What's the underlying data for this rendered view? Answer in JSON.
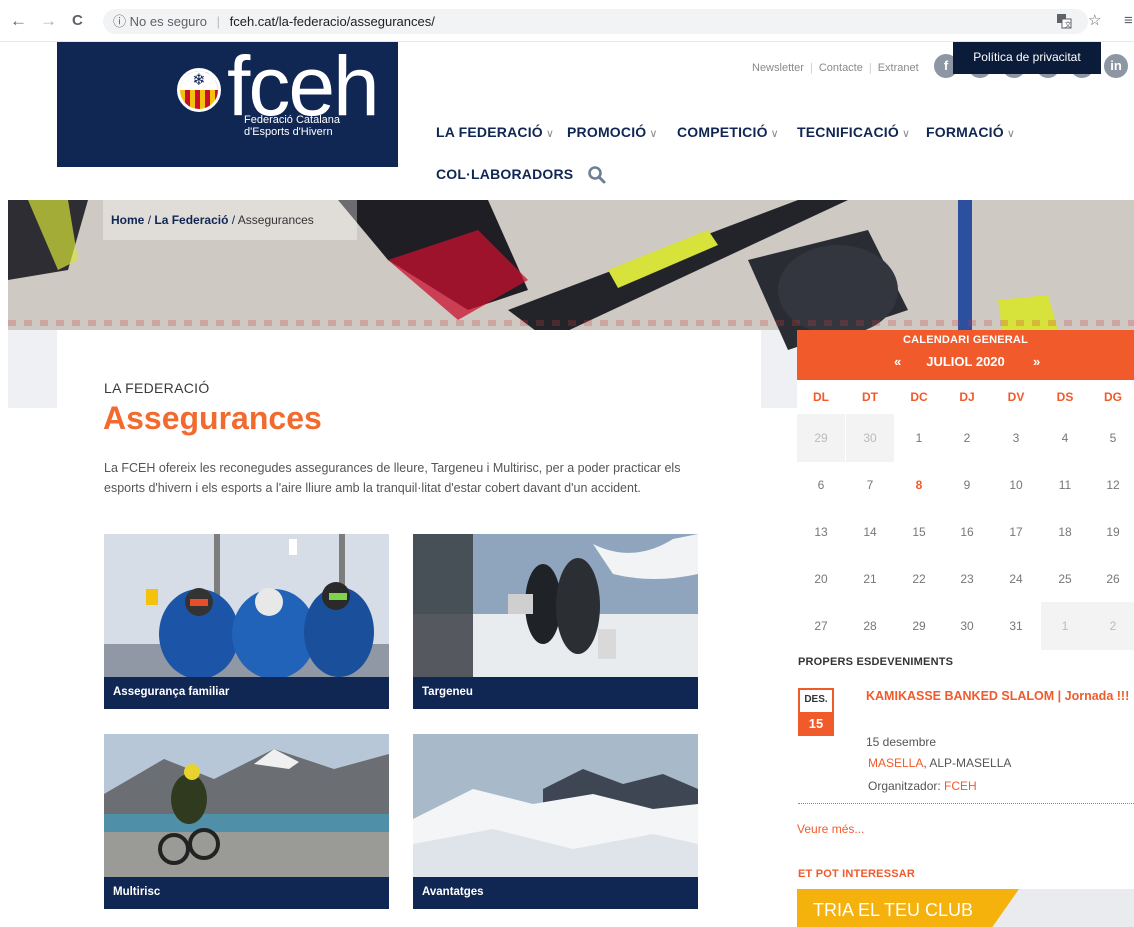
{
  "browser": {
    "back_glyph": "←",
    "forward_glyph": "→",
    "reload_glyph": "C",
    "security_label": "No es seguro",
    "url": "fceh.cat/la-federacio/assegurances/"
  },
  "header": {
    "logo_text": "fceh",
    "logo_sub_1": "Federació Catalana",
    "logo_sub_2": "d'Esports d'Hivern",
    "top_links": [
      "Newsletter",
      "Contacte",
      "Extranet"
    ],
    "privacy_tooltip": "Política de privacitat",
    "social_icons": [
      "facebook-icon",
      "twitter-icon",
      "instagram-icon",
      "youtube-icon",
      "flickr-icon",
      "linkedin-icon"
    ],
    "nav": [
      {
        "label": "LA FEDERACIÓ"
      },
      {
        "label": "PROMOCIÓ"
      },
      {
        "label": "COMPETICIÓ"
      },
      {
        "label": "TECNIFICACIÓ"
      },
      {
        "label": "FORMACIÓ"
      },
      {
        "label": "COL·LABORADORS"
      }
    ],
    "linkedin_glyph": "in"
  },
  "breadcrumb": {
    "home": "Home",
    "sep": "/",
    "parent": "La Federació",
    "current": "Assegurances"
  },
  "main": {
    "section_label": "LA FEDERACIÓ",
    "title": "Assegurances",
    "intro": "La FCEH ofereix les reconegudes assegurances de lleure, Targeneu i Multirisc, per a poder practicar els esports d'hivern i els esports a l'aire lliure amb la tranquil·litat d'estar cobert davant d'un accident.",
    "cards": [
      {
        "label": "Assegurança familiar"
      },
      {
        "label": "Targeneu"
      },
      {
        "label": "Multirisc"
      },
      {
        "label": "Avantatges"
      }
    ]
  },
  "calendar": {
    "title": "CALENDARI GENERAL",
    "month": "JULIOL 2020",
    "prev": "«",
    "next": "»",
    "day_names": [
      "DL",
      "DT",
      "DC",
      "DJ",
      "DV",
      "DS",
      "DG"
    ],
    "weeks": [
      [
        "29",
        "30",
        "1",
        "2",
        "3",
        "4",
        "5"
      ],
      [
        "6",
        "7",
        "8",
        "9",
        "10",
        "11",
        "12"
      ],
      [
        "13",
        "14",
        "15",
        "16",
        "17",
        "18",
        "19"
      ],
      [
        "20",
        "21",
        "22",
        "23",
        "24",
        "25",
        "26"
      ],
      [
        "27",
        "28",
        "29",
        "30",
        "31",
        "1",
        "2"
      ]
    ]
  },
  "events": {
    "title": "PROPERS ESDEVENIMENTS",
    "item": {
      "month": "DES.",
      "day": "15",
      "name": "KAMIKASSE BANKED SLALOM | Jornada !!!",
      "date": "15 desembre",
      "place": "MASELLA",
      "place_rest": ", ALP-MASELLA",
      "organizer_label": "Organitzador:",
      "organizer": "FCEH"
    },
    "see_more": "Veure més..."
  },
  "interest": {
    "title": "ET POT INTERESSAR",
    "banner": "TRIA EL TEU CLUB"
  },
  "colors": {
    "navy": "#102653",
    "orange": "#f15a2b",
    "yellow": "#f5b10c"
  }
}
